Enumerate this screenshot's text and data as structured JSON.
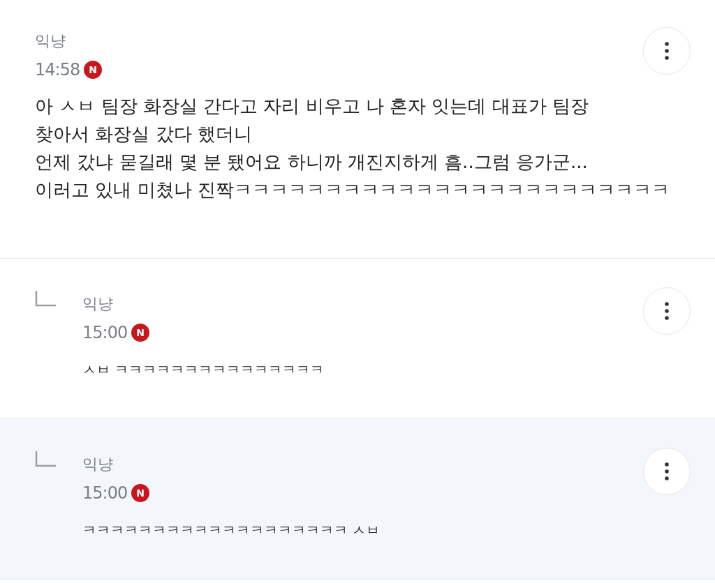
{
  "post": {
    "author": "익냥",
    "time": "14:58",
    "badge": "N",
    "lines": [
      "아 ㅅㅂ 팀장 화장실 간다고 자리 비우고 나 혼자 잇는데 대표가 팀장",
      "찾아서 화장실 갔다 했더니",
      "언제 갔냐 묻길래 몇 분 됐어요 하니까 개진지하게 흠..그럼 응가군...",
      "이러고 있내 미쳤나 진짝ㅋㅋㅋㅋㅋㅋㅋㅋㅋㅋㅋㅋㅋㅋㅋㅋㅋㅋㅋㅋㅋㅋㅋㅋ"
    ]
  },
  "replies": [
    {
      "author": "익냥",
      "time": "15:00",
      "badge": "N",
      "text": "ㅅㅂ ㅋㅋㅋㅋㅋㅋㅋㅋㅋㅋㅋㅋㅋㅋㅋ",
      "highlighted": false
    },
    {
      "author": "익냥",
      "time": "15:00",
      "badge": "N",
      "text": "ㅋㅋㅋㅋㅋㅋㅋㅋㅋㅋㅋㅋㅋㅋㅋㅋㅋㅋㅋ ㅅㅂ",
      "highlighted": true
    }
  ]
}
